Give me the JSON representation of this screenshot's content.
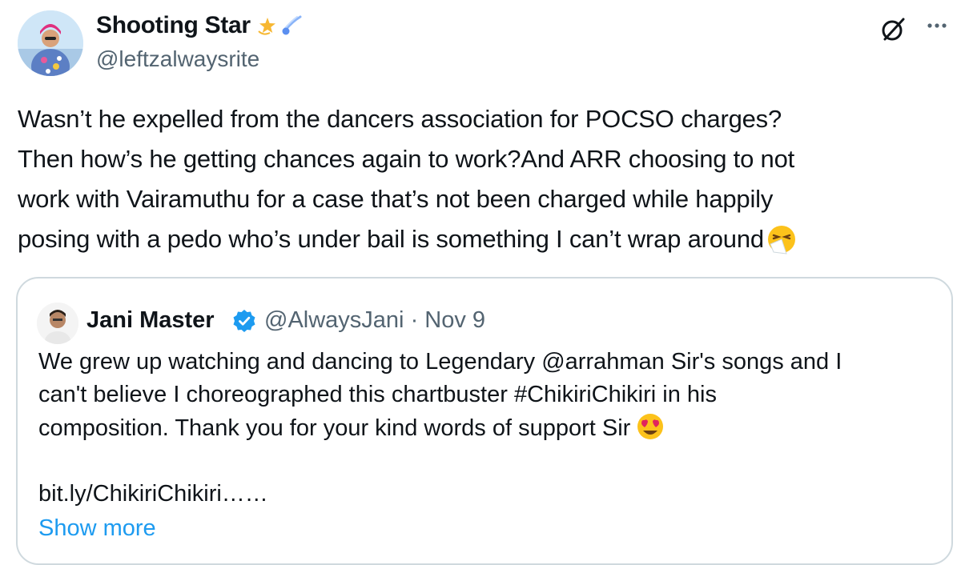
{
  "author": {
    "display_name": "Shooting Star",
    "handle": "@leftzalwaysrite",
    "name_emojis": [
      "dizzy-star-icon",
      "comet-icon"
    ]
  },
  "actions": {
    "grok": "grok-icon",
    "more": "more-options-icon"
  },
  "tweet": {
    "lines": [
      "Wasn’t he expelled from the dancers association for POCSO charges?",
      "Then how’s he getting chances again to work?And ARR choosing to not",
      "work with Vairamuthu for a case that’s not been charged while happily",
      "posing with a pedo who’s under bail is something I can’t wrap around"
    ],
    "end_emoji": "sneezing-face-icon"
  },
  "quote": {
    "display_name": "Jani Master",
    "handle": "@AlwaysJani",
    "separator": "·",
    "date": "Nov 9",
    "lines": [
      "We grew up watching and dancing to Legendary @arrahman Sir's songs and I",
      "can't believe I choreographed this chartbuster #ChikiriChikiri in his",
      "composition. Thank you for your kind words of support Sir",
      "",
      "bit.ly/ChikiriChikiri……"
    ],
    "emoji": "heart-eyes-icon",
    "show_more": "Show more"
  },
  "colors": {
    "text": "#0f1419",
    "secondary": "#536471",
    "link": "#1d9bf0",
    "border": "#cfd9de",
    "verified": "#1d9bf0"
  }
}
